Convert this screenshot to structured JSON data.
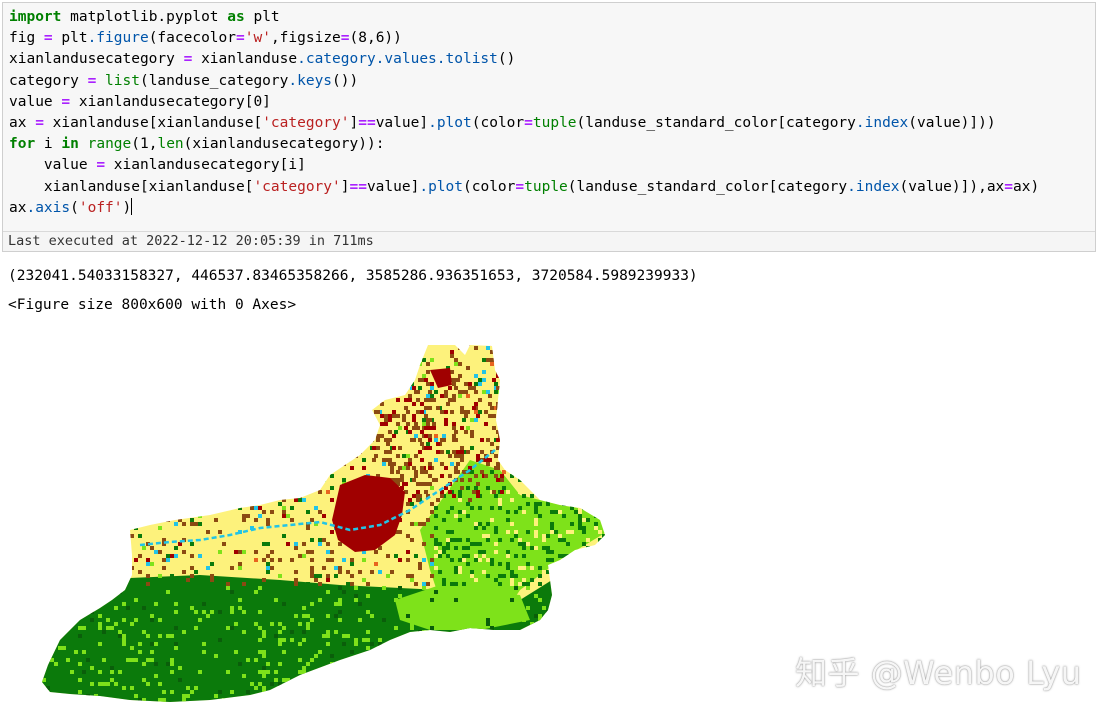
{
  "cell": {
    "code_lines": [
      "import matplotlib.pyplot as plt",
      "fig = plt.figure(facecolor='w',figsize=(8,6))",
      "xianlandusecategory = xianlanduse.category.values.tolist()",
      "category = list(landuse_category.keys())",
      "value = xianlandusecategory[0]",
      "ax = xianlanduse[xianlanduse['category']==value].plot(color=tuple(landuse_standard_color[category.index(value)]))",
      "for i in range(1,len(xianlandusecategory)):",
      "    value = xianlandusecategory[i]",
      "    xianlanduse[xianlanduse['category']==value].plot(color=tuple(landuse_standard_color[category.index(value)]),ax=ax)",
      "ax.axis('off')"
    ],
    "status": "Last executed at 2022-12-12 20:05:39 in 711ms"
  },
  "output": {
    "extent": "(232041.54033158327, 446537.83465358266, 3585286.936351653, 3720584.5989239933)",
    "figure_repr": "<Figure size 800x600 with 0 Axes>"
  },
  "map": {
    "legend_colors": {
      "forest": "#0b7a0b",
      "grassland": "#7ee21a",
      "cropland": "#fdf27c",
      "urban": "#a00000",
      "rural": "#8b4a12",
      "water": "#22c4e6",
      "orange": "#e8641e"
    }
  },
  "watermark": "知乎 @Wenbo Lyu"
}
